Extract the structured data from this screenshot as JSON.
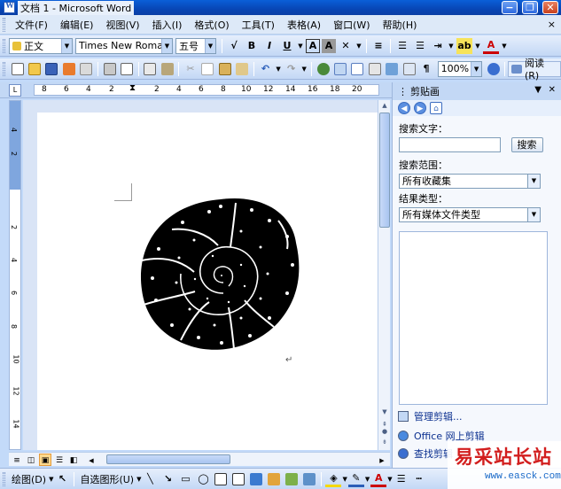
{
  "window": {
    "title": "文档 1 - Microsoft Word",
    "minimize": "−",
    "restore": "❐",
    "close": "✕"
  },
  "menubar": {
    "items": [
      "文件(F)",
      "编辑(E)",
      "视图(V)",
      "插入(I)",
      "格式(O)",
      "工具(T)",
      "表格(A)",
      "窗口(W)",
      "帮助(H)"
    ],
    "doc_close": "×"
  },
  "format_toolbar": {
    "style": "正文",
    "font": "Times New Roman",
    "size": "五号",
    "bold": "B",
    "italic": "I",
    "underline": "U",
    "char_border": "A",
    "char_shading": "A",
    "font_color": "A"
  },
  "standard_toolbar": {
    "zoom": "100%",
    "reading": "阅读(R)"
  },
  "ruler": {
    "h_ticks": [
      "8",
      "6",
      "4",
      "2",
      "2",
      "4",
      "6",
      "8",
      "10",
      "12",
      "14",
      "16",
      "18",
      "20"
    ],
    "v_ticks": [
      "4",
      "2",
      "2",
      "4",
      "6",
      "8",
      "10",
      "12",
      "14"
    ],
    "corner": "L"
  },
  "taskpane": {
    "title": "剪贴画",
    "search_label": "搜索文字：",
    "search_value": "",
    "search_button": "搜索",
    "scope_label": "搜索范围：",
    "scope_value": "所有收藏集",
    "type_label": "结果类型：",
    "type_value": "所有媒体文件类型",
    "links": [
      "管理剪辑...",
      "Office 网上剪辑",
      "查找剪辑"
    ]
  },
  "drawbar": {
    "draw": "绘图(D)",
    "autoshape": "自选图形(U)"
  },
  "watermark": {
    "main": "易采站长站",
    "url": "www.easck.com"
  }
}
